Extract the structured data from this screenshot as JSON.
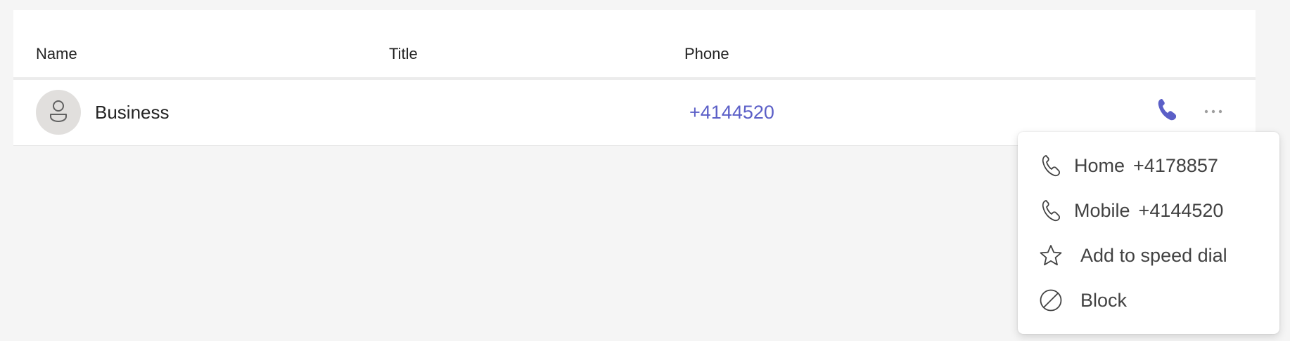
{
  "table": {
    "headers": {
      "name": "Name",
      "title": "Title",
      "phone": "Phone"
    },
    "rows": [
      {
        "name": "Business",
        "title": "",
        "phone": "+4144520"
      }
    ]
  },
  "icons": {
    "avatar": "person-icon",
    "call": "phone-icon",
    "more": "more-options-icon"
  },
  "menu": {
    "items": [
      {
        "label": "Home",
        "number": "+4178857",
        "icon": "phone-icon"
      },
      {
        "label": "Mobile",
        "number": "+4144520",
        "icon": "phone-icon"
      },
      {
        "label": "Add to speed dial",
        "icon": "star-icon"
      },
      {
        "label": "Block",
        "icon": "block-icon"
      }
    ]
  },
  "colors": {
    "accent": "#5b5fc7",
    "background": "#f5f5f5",
    "surface": "#ffffff"
  }
}
